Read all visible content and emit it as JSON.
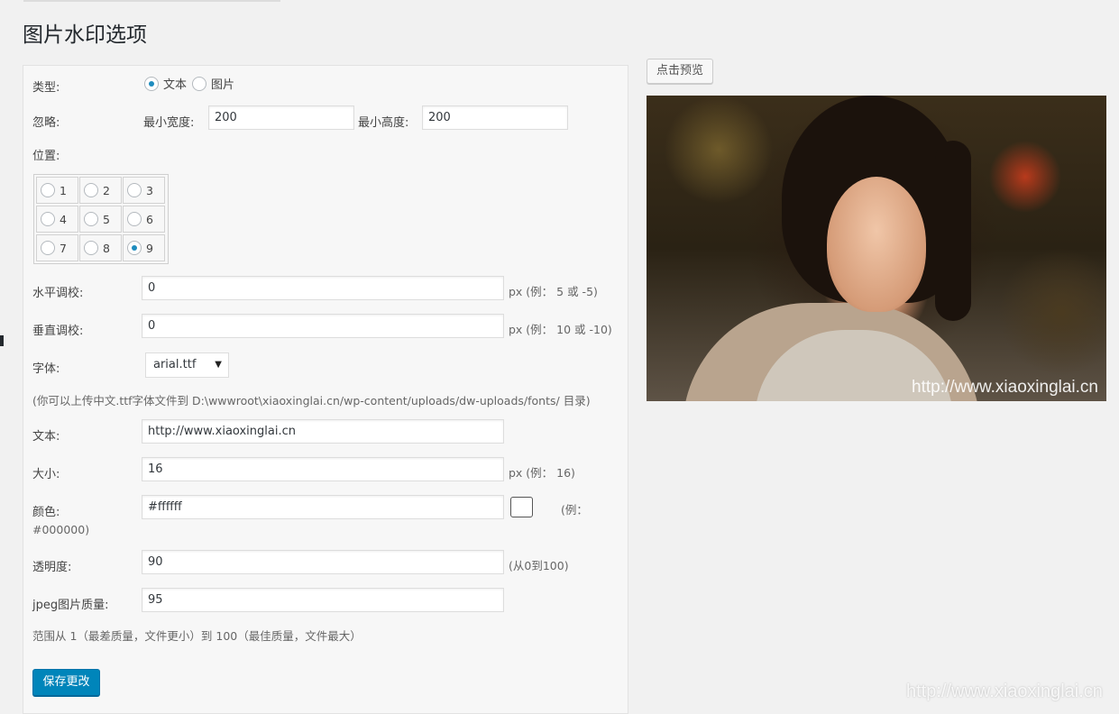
{
  "page": {
    "title": "图片水印选项"
  },
  "form": {
    "type": {
      "label": "类型:",
      "options": [
        "文本",
        "图片"
      ],
      "selected": "文本"
    },
    "ignore": {
      "label": "忽略:",
      "min_width_label": "最小宽度:",
      "min_width": "200",
      "min_height_label": "最小高度:",
      "min_height": "200"
    },
    "position": {
      "label": "位置:",
      "cells": [
        "1",
        "2",
        "3",
        "4",
        "5",
        "6",
        "7",
        "8",
        "9"
      ],
      "selected": "9"
    },
    "h_offset": {
      "label": "水平调校:",
      "value": "0",
      "hint": "px (例： 5 或 -5)"
    },
    "v_offset": {
      "label": "垂直调校:",
      "value": "0",
      "hint": "px (例： 10 或 -10)"
    },
    "font": {
      "label": "字体:",
      "value": "arial.ttf",
      "hint": "(你可以上传中文.ttf字体文件到 D:\\wwwroot\\xiaoxinglai.cn/wp-content/uploads/dw-uploads/fonts/ 目录)"
    },
    "text": {
      "label": "文本:",
      "value": "http://www.xiaoxinglai.cn"
    },
    "size": {
      "label": "大小:",
      "value": "16",
      "hint": "px (例： 16)"
    },
    "color": {
      "label": "颜色:",
      "value": "#ffffff",
      "swatch": "#ffffff",
      "hint_a": "(例：",
      "hint_b": "#000000)"
    },
    "opacity": {
      "label": "透明度:",
      "value": "90",
      "hint": "(从0到100)"
    },
    "jpeg_quality": {
      "label": "jpeg图片质量:",
      "value": "95",
      "hint": "范围从 1（最差质量，文件更小）到 100（最佳质量，文件最大）"
    },
    "save_label": "保存更改"
  },
  "preview": {
    "button_label": "点击预览",
    "watermark_text": "http://www.xiaoxinglai.cn"
  },
  "site_watermark": "http://www.xiaoxinglai.cn",
  "colors": {
    "primary": "#0085ba",
    "radio_checked": "#1e8cbe"
  }
}
